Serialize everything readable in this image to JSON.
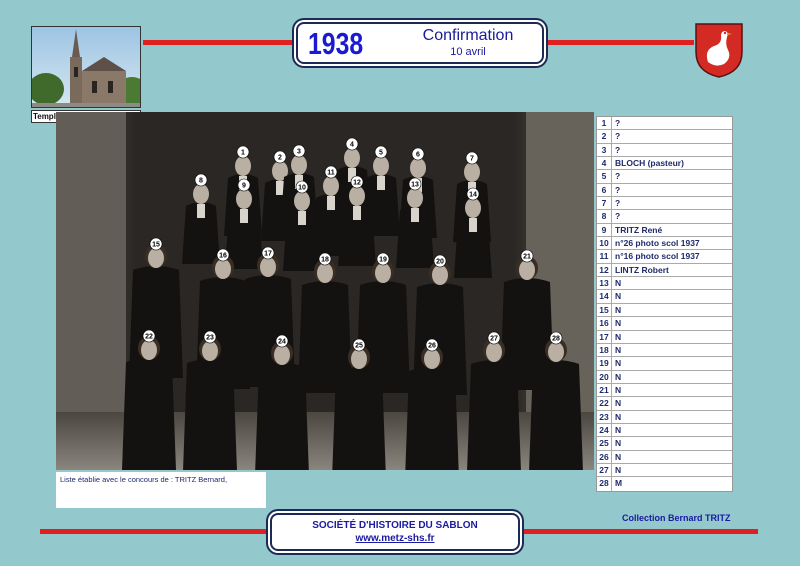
{
  "header": {
    "year": "1938",
    "event": "Confirmation",
    "date": "10 avril"
  },
  "church": {
    "caption": "Temple de Montigny-Sablon"
  },
  "names": [
    {
      "num": "1",
      "name": "?"
    },
    {
      "num": "2",
      "name": "?"
    },
    {
      "num": "3",
      "name": "?"
    },
    {
      "num": "4",
      "name": "BLOCH (pasteur)"
    },
    {
      "num": "5",
      "name": "?"
    },
    {
      "num": "6",
      "name": "?"
    },
    {
      "num": "7",
      "name": "?"
    },
    {
      "num": "8",
      "name": "?"
    },
    {
      "num": "9",
      "name": "TRITZ René"
    },
    {
      "num": "10",
      "name": "n°26 photo scol 1937"
    },
    {
      "num": "11",
      "name": "n°16 photo scol 1937"
    },
    {
      "num": "12",
      "name": "LINTZ Robert"
    },
    {
      "num": "13",
      "name": "N"
    },
    {
      "num": "14",
      "name": "N"
    },
    {
      "num": "15",
      "name": "N"
    },
    {
      "num": "16",
      "name": "N"
    },
    {
      "num": "17",
      "name": "N"
    },
    {
      "num": "18",
      "name": "N"
    },
    {
      "num": "19",
      "name": "N"
    },
    {
      "num": "20",
      "name": "N"
    },
    {
      "num": "21",
      "name": "N"
    },
    {
      "num": "22",
      "name": "N"
    },
    {
      "num": "23",
      "name": "N"
    },
    {
      "num": "24",
      "name": "N"
    },
    {
      "num": "25",
      "name": "N"
    },
    {
      "num": "26",
      "name": "N"
    },
    {
      "num": "27",
      "name": "N"
    },
    {
      "num": "28",
      "name": "M"
    }
  ],
  "photo_markers": [
    "1",
    "2",
    "3",
    "4",
    "5",
    "6",
    "7",
    "8",
    "9",
    "10",
    "11",
    "12",
    "13",
    "14",
    "15",
    "16",
    "17",
    "18",
    "19",
    "20",
    "21",
    "22",
    "23",
    "24",
    "25",
    "26",
    "27",
    "28"
  ],
  "note": "Liste établie avec le concours de : TRITZ Bernard,",
  "collection": "Collection Bernard TRITZ",
  "footer": {
    "society": "SOCIÉTÉ D'HISTOIRE DU SABLON",
    "website": "www.metz-shs.fr"
  },
  "colors": {
    "background": "#93c9cc",
    "accent_red": "#e02020",
    "title_blue": "#1a1ad0",
    "text_navy": "#1e2a6a"
  }
}
